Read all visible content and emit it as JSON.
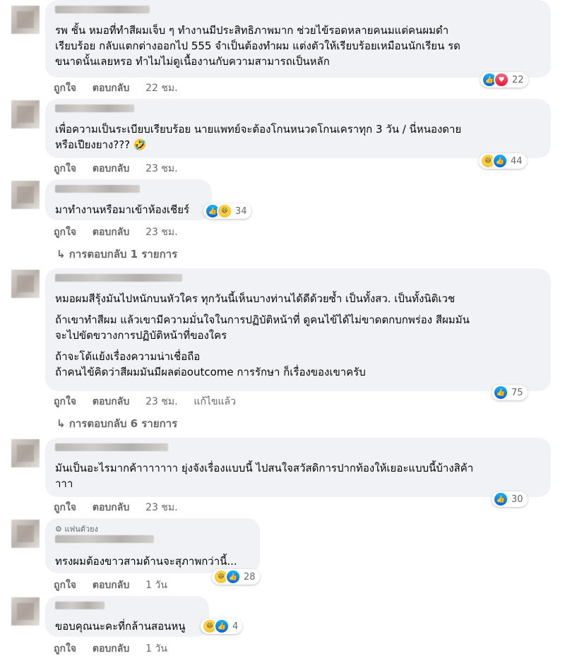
{
  "labels": {
    "like": "ถูกใจ",
    "reply": "ตอบกลับ",
    "edited": "แก้ไขแล้ว"
  },
  "comments": [
    {
      "text_lines": [
        "รพ ชั้น หมอที่ทำสีผมเจ็บ ๆ ทำงานมีประสิทธิภาพมาก ช่วยไข้รอดหลายคนมแต่คนผมดำ",
        "เรียบร้อย กลับแตกต่างออกไป 555 จำเป็นต้องทำผม แต่งตัวให้เรียบร้อยเหมือนนักเรียน รด",
        "ขนาดนั้นเลยหรอ ทำไมไม่ดูเนื้องานกับความสามารถเป็นหลัก"
      ],
      "time": "22 ชม.",
      "reactions": [
        "like-icon",
        "love-icon"
      ],
      "count": "22"
    },
    {
      "text_lines": [
        "เพื่อความเป็นระเบียบเรียบร้อย นายแพทย์จะต้องโกนหนวดโกนเคราทุก 3 วัน / นี่หนองดาย",
        "หรือเปียงยาง??? 🤣"
      ],
      "time": "23 ชม.",
      "reactions": [
        "haha-icon",
        "like-icon"
      ],
      "count": "44"
    },
    {
      "text_lines": [
        "มาทำงานหรือมาเข้าห้องเชียร์"
      ],
      "time": "23 ชม.",
      "reactions": [
        "like-icon",
        "haha-icon"
      ],
      "count": "34",
      "replies": "การตอบกลับ 1 รายการ"
    },
    {
      "text_lines": [
        "หมอผมสีรุ้งมันไปหนักบนหัวใคร ทุกวันนี้เห็นบางท่านได้ดีด้วยซ้ำ เป็นทั้งสว. เป็นทั้งนิติเวช"
      ],
      "paragraphs": [
        [
          "ถ้าเขาทำสีผม แล้วเขามีความมั่นใจในการปฏิบัติหน้าที่ ดูคนไข้ได้ไม่ขาดตกบกพร่อง สีผมมัน",
          "จะไปขัดขวางการปฏิบัติหน้าที่ของใคร"
        ],
        [
          "ถ้าจะโต้แย้งเรื่องความน่าเชื่อถือ",
          "ถ้าคนไข้คิดว่าสีผมมันมีผลต่อoutcome การรักษา ก็เรื่องของเขาครับ"
        ]
      ],
      "time": "23 ชม.",
      "edited": true,
      "reactions": [
        "like-icon"
      ],
      "count": "75",
      "replies": "การตอบกลับ 6 รายการ"
    },
    {
      "text_lines": [
        "มันเป็นอะไรมากค้าาาาาาา ยุ่งจังเรื่องแบบนี้ ไปสนใจสวัสดิการปากท้องให้เยอะแบบนี้บ้างสิค้า",
        "าาา"
      ],
      "time": "23 ชม.",
      "reactions": [
        "like-icon"
      ],
      "count": "30"
    },
    {
      "badge": "แฟนตัวยง",
      "text_lines": [
        "ทรงผมต้องขาวสามด้านจะสุภาพกว่านี้..."
      ],
      "time": "1 วัน",
      "reactions": [
        "haha-icon",
        "like-icon"
      ],
      "count": "28"
    },
    {
      "text_lines": [
        "ขอบคุณนะคะที่กล้านสอนหนู"
      ],
      "time": "1 วัน",
      "reactions": [
        "haha-icon",
        "like-icon"
      ],
      "count": "4"
    }
  ]
}
